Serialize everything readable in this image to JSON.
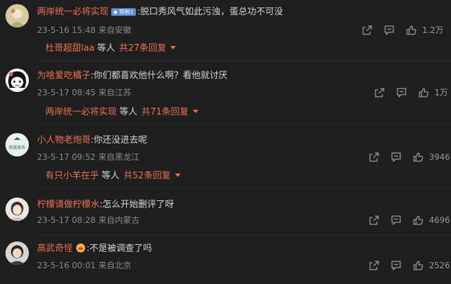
{
  "comments": [
    {
      "username": "两岸统一必将实现",
      "badge": "铁粉1",
      "text": ":脱口秀风气如此污浊，蛋总功不可没",
      "time": "23-5-16 15:48",
      "source": "来自安徽",
      "likes": "1.2万",
      "reply_user": "杜哥超甜laa",
      "reply_etc": "等人",
      "reply_count": "共27条回复"
    },
    {
      "username": "为啥爱吃橘子",
      "text": ":你们都喜欢他什么啊？看他就讨厌",
      "time": "23-5-17 08:45",
      "source": "来自江苏",
      "likes": "1万",
      "reply_user": "两岸统一必将实现",
      "reply_etc": "等人",
      "reply_count": "共71条回复"
    },
    {
      "username": "小人物老炮哥",
      "text": ":你还没进去呢",
      "time": "23-5-17 09:52",
      "source": "来自黑龙江",
      "likes": "3946",
      "avatar_text": "权威发布",
      "reply_user": "有只小羊在乎",
      "reply_etc": "等人",
      "reply_count": "共52条回复"
    },
    {
      "username": "柠檬请做柠檬水",
      "text": ":怎么开始删评了呀",
      "time": "23-5-17 08:28",
      "source": "来自内蒙古",
      "likes": "4696"
    },
    {
      "username": "高武奇怪",
      "text": ":不是被调查了吗",
      "time": "23-5-16 00:01",
      "source": "来自北京",
      "likes": "2526"
    }
  ],
  "colors": {
    "background": "#1e1e1e",
    "username": "#eb7350",
    "text": "#d6d6d6",
    "meta": "#8b8b8b",
    "badge": "#5a8fd6"
  },
  "icons": [
    "share-icon",
    "comment-icon",
    "like-icon",
    "vip-crown-icon",
    "dropdown-caret-icon"
  ]
}
